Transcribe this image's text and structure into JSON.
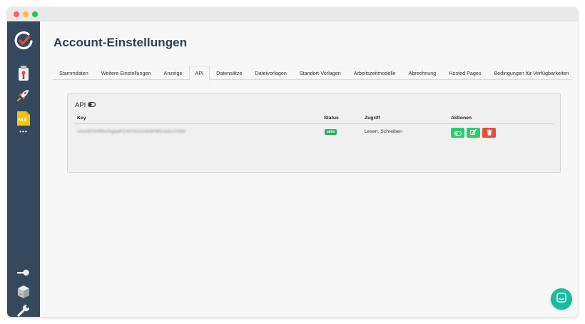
{
  "page": {
    "title": "Account-Einstellungen"
  },
  "tabs": [
    {
      "label": "Stammdaten"
    },
    {
      "label": "Weitere Einstellungen"
    },
    {
      "label": "Anzeige"
    },
    {
      "label": "API",
      "active": true
    },
    {
      "label": "Datensätze"
    },
    {
      "label": "Dateivorlagen"
    },
    {
      "label": "Standort-Vorlagen"
    },
    {
      "label": "Arbeitszeitmodelle"
    },
    {
      "label": "Abrechnung"
    },
    {
      "label": "Hosted Pages"
    },
    {
      "label": "Bedingungen für Verfügbarkeiten"
    }
  ],
  "api_panel": {
    "title": "API",
    "headers": {
      "key": "Key",
      "status": "Status",
      "access": "Zugriff",
      "actions": "Aktionen"
    },
    "rows": [
      {
        "key": "uheNEHHRbnNgbaPZXFFKOxWdKMDcbdsXXlibi",
        "status": "aktiv",
        "access": "Lesen, Schreiben"
      }
    ]
  },
  "sidebar": {
    "icons": [
      "clock-check-icon",
      "badge-icon",
      "rocket-icon",
      "file-icon",
      "more-icon",
      "key-icon",
      "box-icon",
      "wrench-icon"
    ],
    "file_label": "FILE",
    "more_label": "•••"
  },
  "colors": {
    "sidebar": "#34495e",
    "accent_green": "#2ecc71",
    "danger_red": "#e74c3c",
    "status_green": "#27ae60",
    "chat_teal": "#1abc9c"
  }
}
